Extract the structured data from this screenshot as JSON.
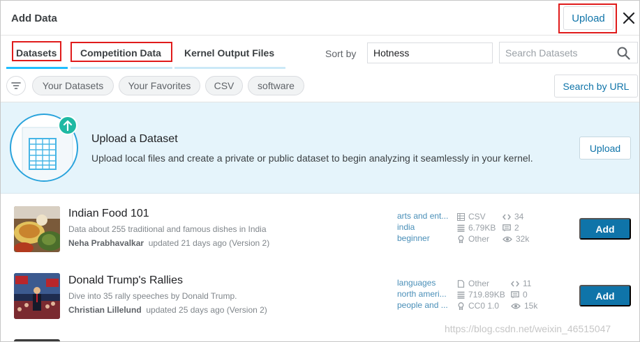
{
  "header": {
    "title": "Add Data",
    "upload_label": "Upload",
    "close_icon": "close-icon"
  },
  "tabs": [
    {
      "label": "Datasets",
      "underline_color": "#20beff"
    },
    {
      "label": "Competition Data",
      "underline_color": "#cbe9f7"
    },
    {
      "label": "Kernel Output Files",
      "underline_color": "#cbe9f7"
    }
  ],
  "sort": {
    "label": "Sort by",
    "value": "Hotness"
  },
  "search": {
    "placeholder": "Search Datasets",
    "icon": "search-icon"
  },
  "filters": {
    "icon": "filter-icon",
    "chips": [
      "Your Datasets",
      "Your Favorites",
      "CSV",
      "software"
    ],
    "search_by_url": "Search by URL"
  },
  "banner": {
    "title": "Upload a Dataset",
    "description": "Upload local files and create a private or public dataset to begin analyzing it seamlessly in your kernel.",
    "upload_label": "Upload",
    "icon": "spreadsheet-upload-icon"
  },
  "datasets": [
    {
      "title": "Indian Food 101",
      "description": "Data about 255 traditional and famous dishes in India",
      "author": "Neha Prabhavalkar",
      "updated": "updated 21 days ago (Version 2)",
      "tags": [
        "arts and ent...",
        "india",
        "beginner"
      ],
      "format": "CSV",
      "size": "6.79KB",
      "license": "Other",
      "kernels": "34",
      "discussions": "2",
      "views": "32k",
      "add_label": "Add",
      "thumbnail": "indian-food-thumbnail"
    },
    {
      "title": "Donald Trump's Rallies",
      "description": "Dive into 35 rally speeches by Donald Trump.",
      "author": "Christian Lillelund",
      "updated": "updated 25 days ago (Version 2)",
      "tags": [
        "languages",
        "north ameri...",
        "people and ..."
      ],
      "format": "Other",
      "size": "719.89KB",
      "license": "CC0 1.0",
      "kernels": "11",
      "discussions": "0",
      "views": "15k",
      "add_label": "Add",
      "thumbnail": "trump-rally-thumbnail"
    }
  ],
  "watermark": "https://blog.csdn.net/weixin_46515047",
  "colors": {
    "accent": "#0f74a9",
    "highlight_box": "#e01b1b",
    "banner_bg": "#e5f4fb",
    "tag_color": "#4a8fb8"
  }
}
